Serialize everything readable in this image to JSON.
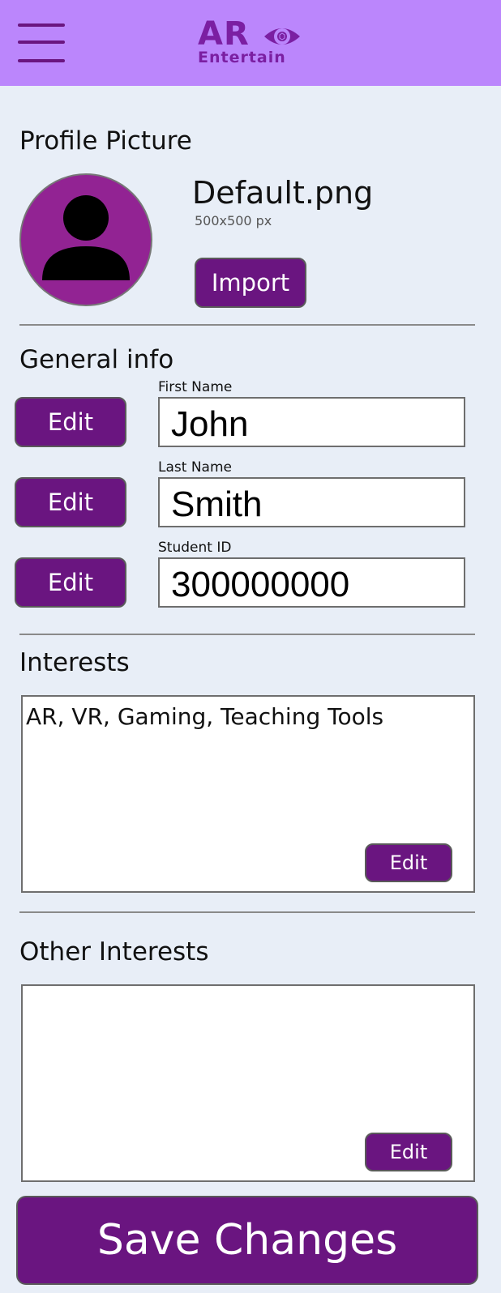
{
  "header": {
    "menu_icon": "hamburger-menu-icon",
    "logo": {
      "main": "AR",
      "sub": "Entertain",
      "icon": "eye-icon"
    },
    "background_color": "#bb86fc",
    "accent_color": "#6a1580"
  },
  "profile_picture": {
    "title": "Profile Picture",
    "avatar_icon": "user-silhouette-icon",
    "file_name": "Default.png",
    "file_size": "500x500 px",
    "import_label": "Import"
  },
  "general_info": {
    "title": "General info",
    "fields": [
      {
        "label": "First Name",
        "value": "John",
        "edit_label": "Edit"
      },
      {
        "label": "Last Name",
        "value": "Smith",
        "edit_label": "Edit"
      },
      {
        "label": "Student ID",
        "value": "300000000",
        "edit_label": "Edit"
      }
    ]
  },
  "interests": {
    "title": "Interests",
    "value": "AR, VR, Gaming, Teaching Tools",
    "edit_label": "Edit"
  },
  "other_interests": {
    "title": "Other Interests",
    "value": "",
    "edit_label": "Edit"
  },
  "save_label": "Save Changes"
}
